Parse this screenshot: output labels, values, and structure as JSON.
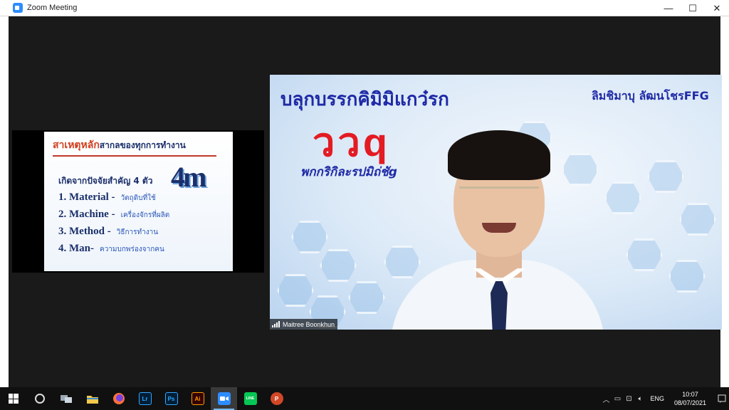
{
  "window": {
    "title": "Zoom Meeting",
    "controls": {
      "minimize": "—",
      "maximize": "☐",
      "close": "✕"
    }
  },
  "share": {
    "slide_title_red": "สาเหตุหลัก",
    "slide_title_rest": "สากลของทุกการทำงาน",
    "slide_subtitle": "เกิดจากปัจจัยสำคัญ 4 ตัว",
    "logo": "4m",
    "items": [
      {
        "main": "1. Material  -",
        "thai": "วัตถุดิบที่ใช้"
      },
      {
        "main": "2. Machine  -",
        "thai": "เครื่องจักรที่ผลิต"
      },
      {
        "main": "3. Method  -",
        "thai": "วิธีการทำงาน"
      },
      {
        "main": "4. Man-",
        "thai": "ความบกพร่องจากคน"
      }
    ]
  },
  "video": {
    "banner_top_left": "บลุกบรรกคิมิมิแกว๋รก",
    "banner_top_right": "ลิมชิมาบุ ลัฒนโชรFFG",
    "banner_red": "ววq",
    "banner_bottom": "พกกริกิละรปมิถ่ชัg",
    "participant_name": "Maitree Boonkhun"
  },
  "taskbar": {
    "apps": [
      {
        "name": "start",
        "label": ""
      },
      {
        "name": "cortana",
        "label": ""
      },
      {
        "name": "task-view",
        "label": ""
      },
      {
        "name": "file-explorer",
        "label": ""
      },
      {
        "name": "firefox",
        "label": ""
      },
      {
        "name": "lightroom",
        "label": "Lr",
        "color": "#31a8ff",
        "bg": "#001e36"
      },
      {
        "name": "photoshop",
        "label": "Ps",
        "color": "#31a8ff",
        "bg": "#001e36"
      },
      {
        "name": "illustrator",
        "label": "Ai",
        "color": "#ff9a00",
        "bg": "#330000"
      },
      {
        "name": "zoom",
        "label": ""
      },
      {
        "name": "line",
        "label": "LINE"
      },
      {
        "name": "powerpoint",
        "label": "P"
      }
    ],
    "language": "ENG",
    "time": "10:07",
    "date": "08/07/2021"
  }
}
